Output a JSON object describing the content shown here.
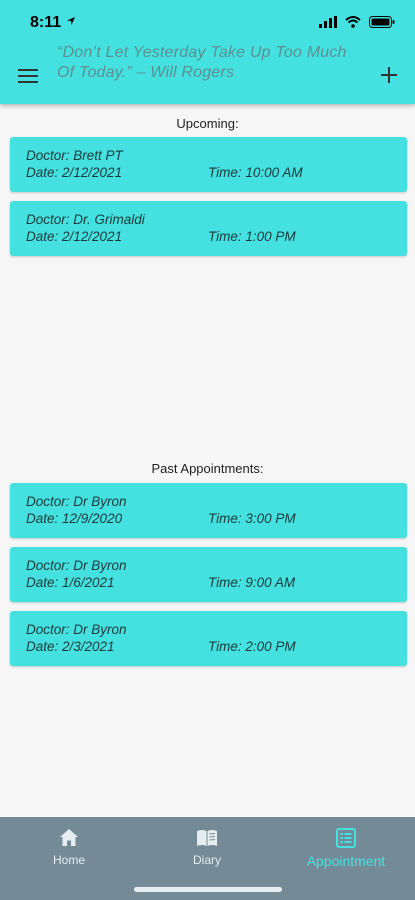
{
  "status": {
    "time": "8:11"
  },
  "header": {
    "quote": "“Don’t Let Yesterday Take Up Too Much Of Today.” – Will Rogers"
  },
  "upcoming": {
    "title": "Upcoming:",
    "items": [
      {
        "doctor": "Doctor: Brett PT",
        "date": "Date: 2/12/2021",
        "time": "Time: 10:00 AM"
      },
      {
        "doctor": "Doctor: Dr. Grimaldi",
        "date": "Date: 2/12/2021",
        "time": "Time: 1:00 PM"
      }
    ]
  },
  "past": {
    "title": "Past Appointments:",
    "items": [
      {
        "doctor": "Doctor: Dr Byron",
        "date": "Date: 12/9/2020",
        "time": "Time: 3:00 PM"
      },
      {
        "doctor": "Doctor: Dr Byron",
        "date": "Date: 1/6/2021",
        "time": "Time: 9:00 AM"
      },
      {
        "doctor": "Doctor: Dr Byron",
        "date": "Date: 2/3/2021",
        "time": "Time: 2:00 PM"
      }
    ]
  },
  "tabs": [
    {
      "label": "Home",
      "icon": "home-icon"
    },
    {
      "label": "Diary",
      "icon": "book-icon"
    },
    {
      "label": "Appointment",
      "icon": "list-icon",
      "active": true
    }
  ],
  "colors": {
    "accent": "#45e0e0",
    "tabbar": "#748b97",
    "quote": "#5f8f8f"
  }
}
